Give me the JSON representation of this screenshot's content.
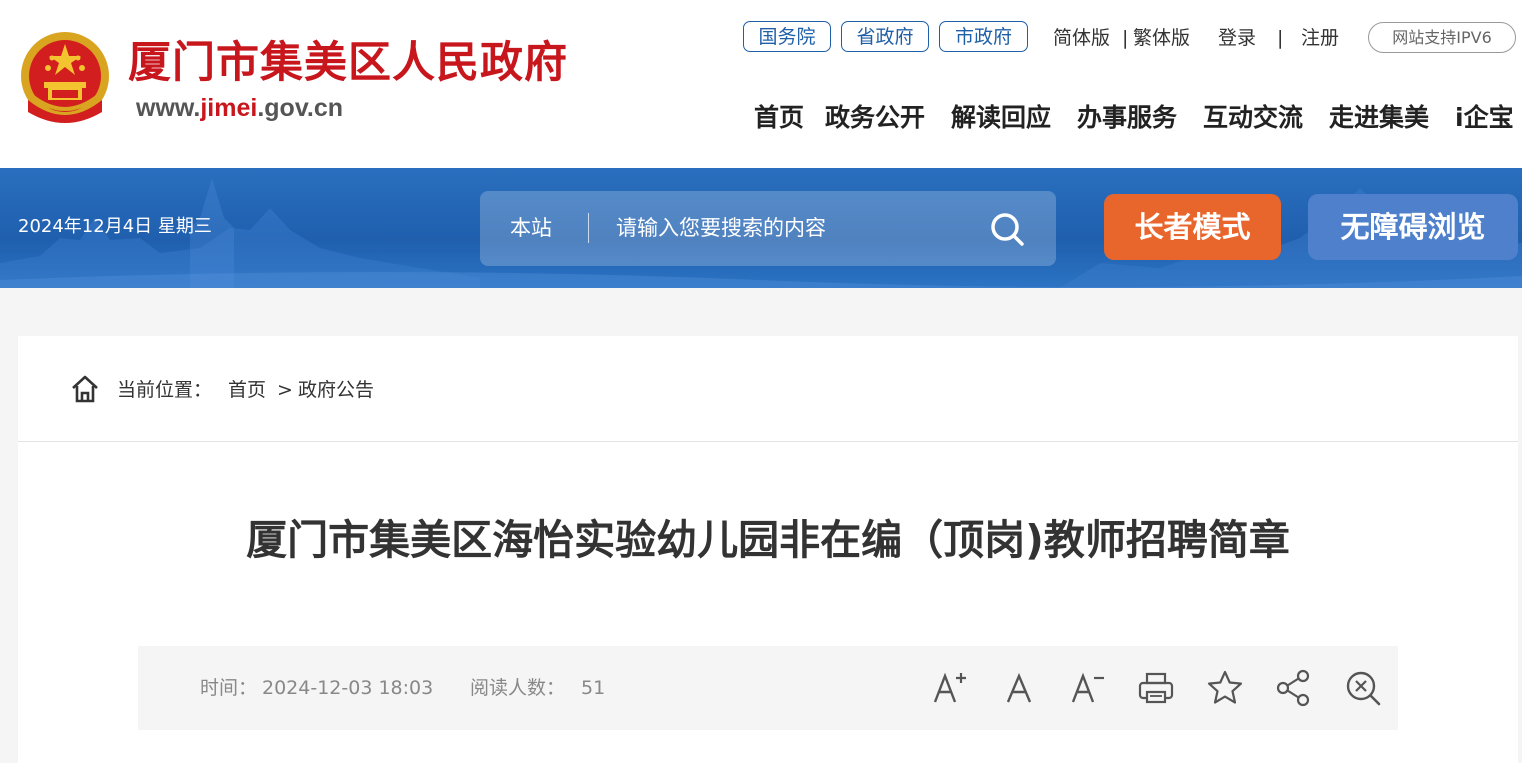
{
  "header": {
    "site_title": "厦门市集美区人民政府",
    "url_prefix": "www.",
    "url_highlight": "jimei",
    "url_suffix": ".gov.cn",
    "gov_links": [
      "国务院",
      "省政府",
      "市政府"
    ],
    "lang_simplified": "简体版",
    "lang_separator": "|",
    "lang_traditional": "繁体版",
    "login": "登录",
    "auth_separator": "|",
    "register": "注册",
    "ipv6_badge": "网站支持IPV6",
    "nav": [
      "首页",
      "政务公开",
      "解读回应",
      "办事服务",
      "互动交流",
      "走进集美",
      "i企宝"
    ]
  },
  "banner": {
    "date": "2024年12月4日 星期三",
    "search_scope": "本站",
    "search_placeholder": "请输入您要搜索的内容",
    "elder_mode": "长者模式",
    "accessible_mode": "无障碍浏览"
  },
  "breadcrumb": {
    "label": "当前位置：",
    "home": "首页",
    "separator": ">",
    "current": "政府公告"
  },
  "article": {
    "title": "厦门市集美区海怡实验幼儿园非在编（顶岗)教师招聘简章",
    "time_label": "时间：",
    "time_value": "2024-12-03 18:03",
    "reads_label": "阅读人数：",
    "reads_value": "51"
  },
  "icons": {
    "font_increase": "font-increase-icon",
    "font_default": "font-default-icon",
    "font_decrease": "font-decrease-icon",
    "print": "print-icon",
    "favorite": "star-icon",
    "share": "share-icon",
    "close": "close-zoom-icon"
  },
  "colors": {
    "brand_red": "#c8161d",
    "nav_blue": "#1f5fa8",
    "elder_orange": "#e8662c",
    "accessible_blue": "#4f80cc"
  }
}
